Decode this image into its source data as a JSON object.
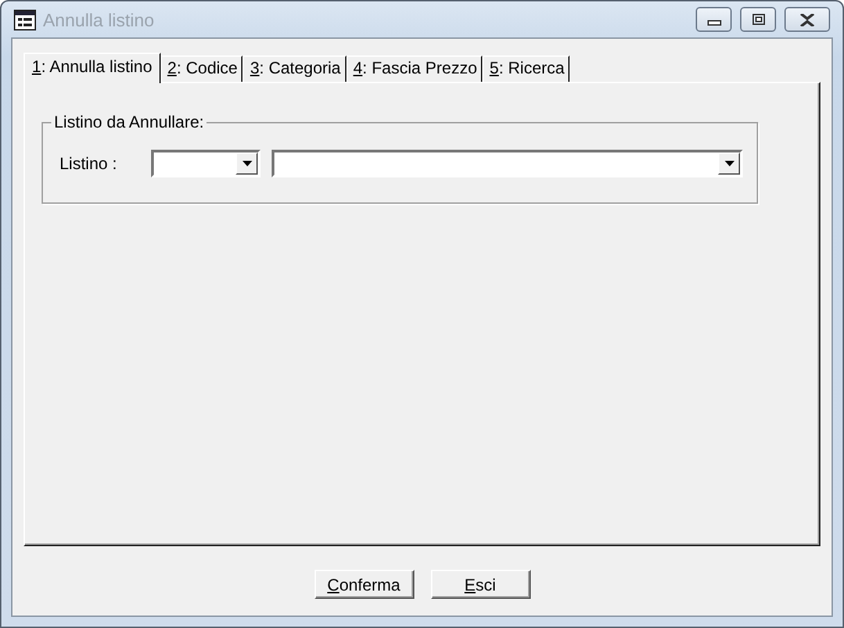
{
  "window": {
    "title": "Annulla listino"
  },
  "tabs": [
    {
      "label": "1: Annulla listino",
      "selected": true
    },
    {
      "label": "2: Codice",
      "selected": false
    },
    {
      "label": "3: Categoria",
      "selected": false
    },
    {
      "label": "4: Fascia Prezzo",
      "selected": false
    },
    {
      "label": "5: Ricerca",
      "selected": false
    }
  ],
  "group": {
    "title": "Listino da Annullare:",
    "field_label": "Listino :",
    "combos": [
      {
        "kind": "short"
      },
      {
        "kind": "long"
      }
    ]
  },
  "buttons": [
    {
      "label": "Conferma"
    },
    {
      "label": "Esci"
    }
  ]
}
